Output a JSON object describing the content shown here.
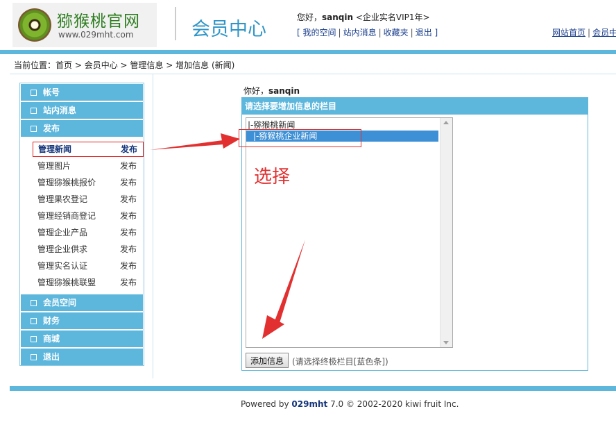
{
  "header": {
    "logo_title": "猕猴桃官网",
    "logo_url": "www.029mht.com",
    "center_title": "会员中心",
    "greeting_prefix": "您好，",
    "username": "sanqin",
    "membership": "<企业实名VIP1年>",
    "user_links": [
      "我的空间",
      "站内消息",
      "收藏夹",
      "退出"
    ],
    "site_links": [
      "网站首页",
      "会员中"
    ]
  },
  "breadcrumb": {
    "label": "当前位置：",
    "items": [
      "首页",
      "会员中心",
      "管理信息",
      "增加信息 (新闻)"
    ]
  },
  "sidebar": {
    "section_account": "帐号",
    "section_messages": "站内消息",
    "section_publish": "发布",
    "publish_items": [
      {
        "name": "管理新闻",
        "action": "发布"
      },
      {
        "name": "管理图片",
        "action": "发布"
      },
      {
        "name": "管理猕猴桃报价",
        "action": "发布"
      },
      {
        "name": "管理果农登记",
        "action": "发布"
      },
      {
        "name": "管理经销商登记",
        "action": "发布"
      },
      {
        "name": "管理企业产品",
        "action": "发布"
      },
      {
        "name": "管理企业供求",
        "action": "发布"
      },
      {
        "name": "管理实名认证",
        "action": "发布"
      },
      {
        "name": "管理猕猴桃联盟",
        "action": "发布"
      }
    ],
    "section_space": "会员空间",
    "section_finance": "财务",
    "section_shop": "商城",
    "section_logout": "退出"
  },
  "main": {
    "hello_prefix": "你好，",
    "hello_user": "sanqin",
    "panel_title": "请选择要增加信息的栏目",
    "options": [
      "|-猕猴桃新闻",
      "|-猕猴桃企业新闻"
    ],
    "selected_index": 1,
    "add_button": "添加信息",
    "add_hint": "(请选择终极栏目[蓝色条])"
  },
  "annotation": {
    "text": "选择",
    "color": "#e23030"
  },
  "footer": {
    "powered_by": "Powered by",
    "brand": "029mht",
    "version": "7.0",
    "copyright": "© 2002-2020 kiwi fruit Inc."
  },
  "colors": {
    "accent": "#5db6dc",
    "selection": "#3d8fd6",
    "link": "#1a3e8c"
  }
}
